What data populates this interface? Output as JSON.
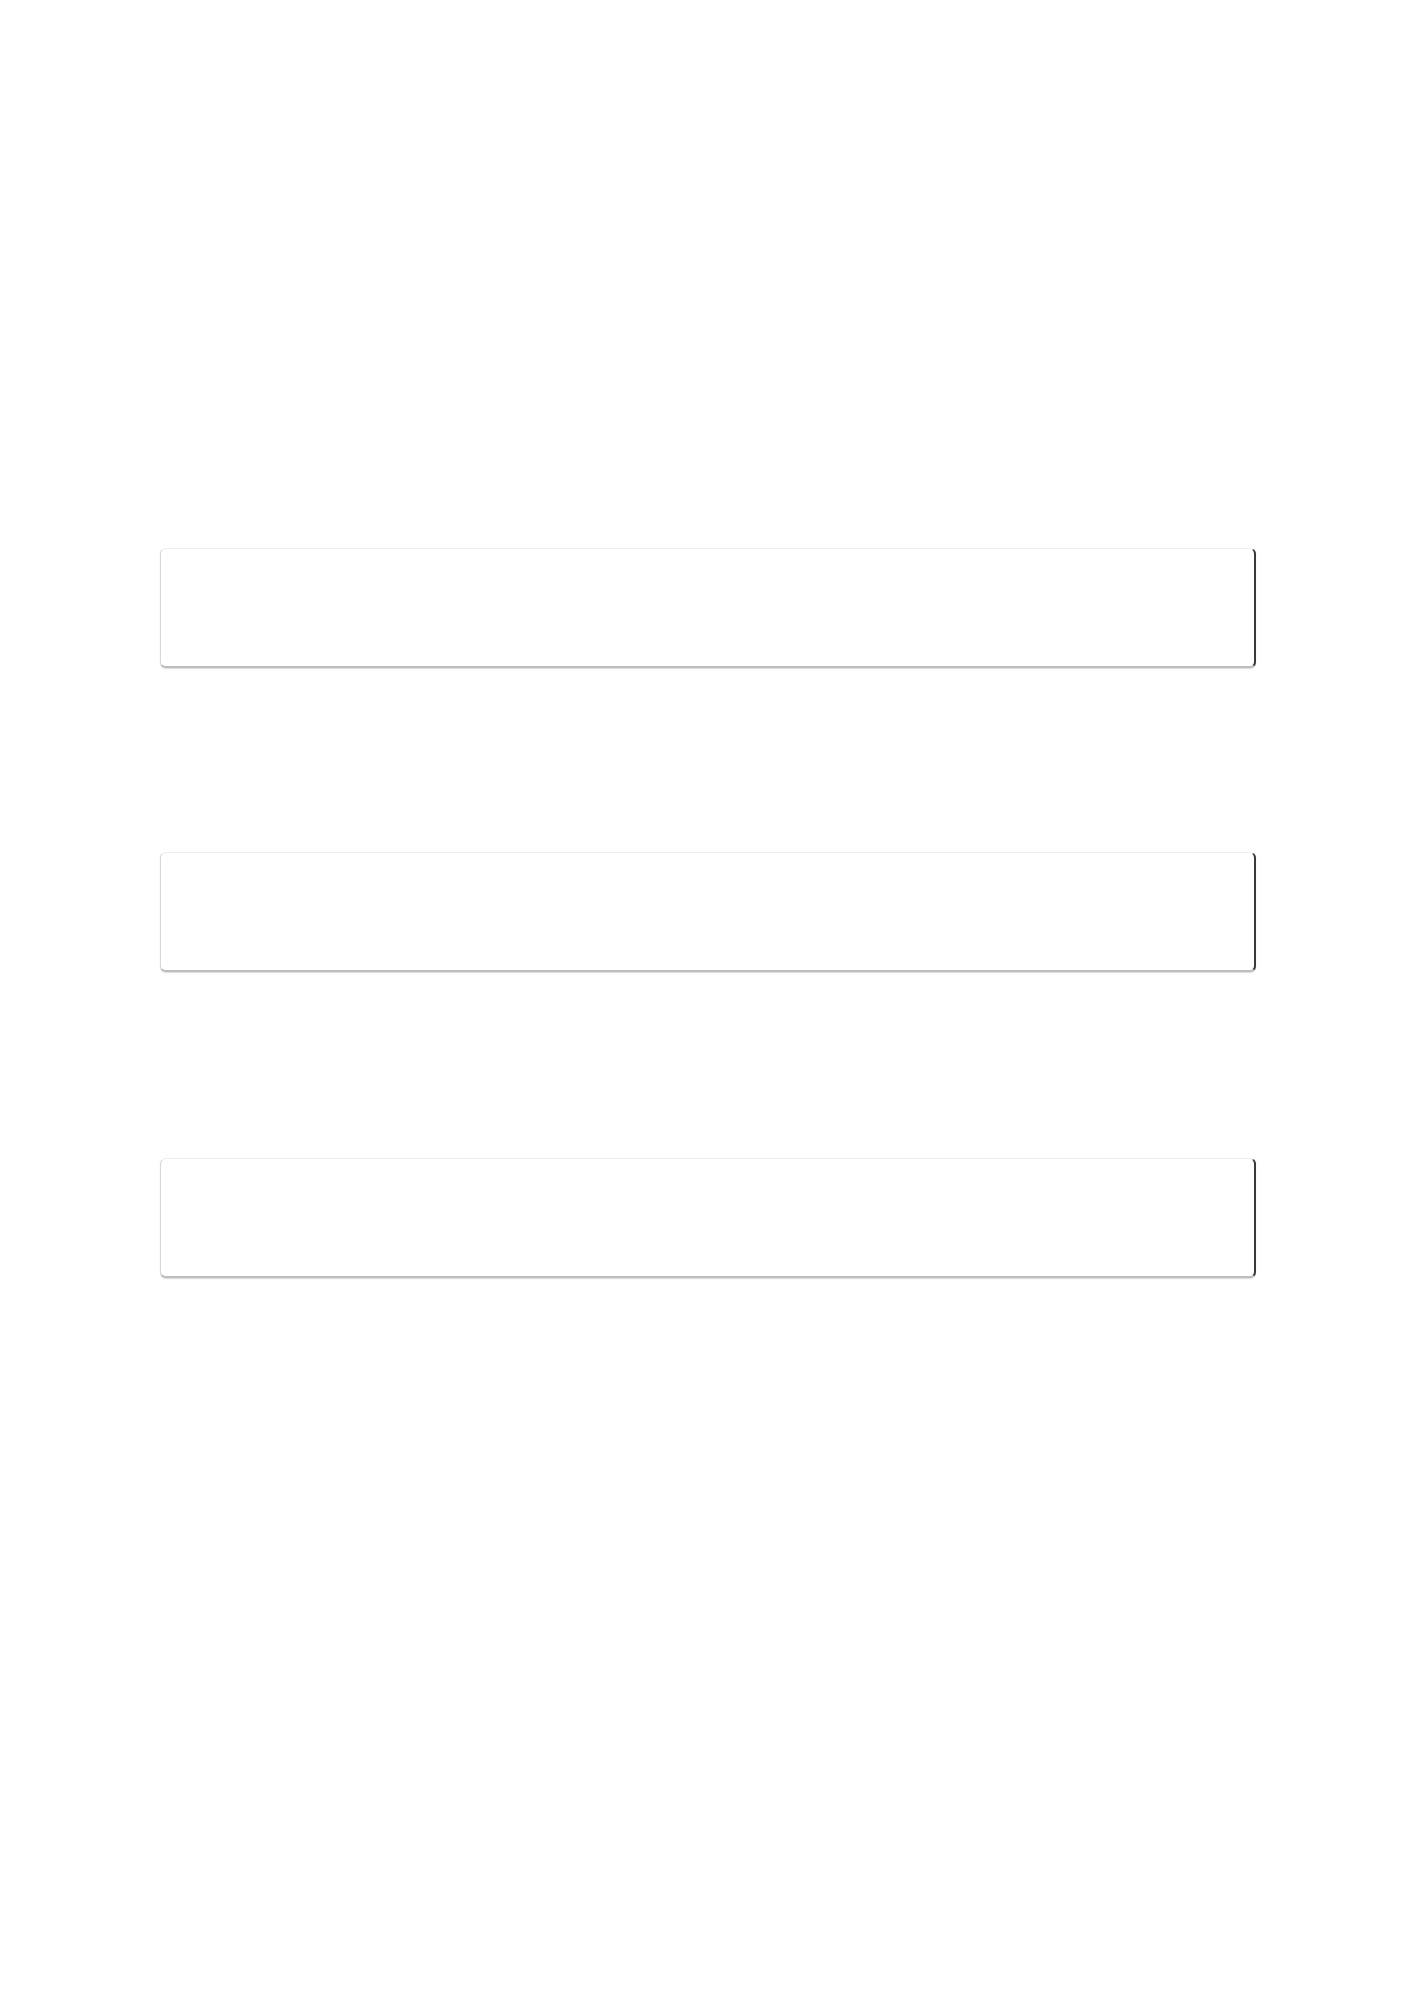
{
  "fields": [
    {
      "value": ""
    },
    {
      "value": ""
    },
    {
      "value": ""
    }
  ]
}
